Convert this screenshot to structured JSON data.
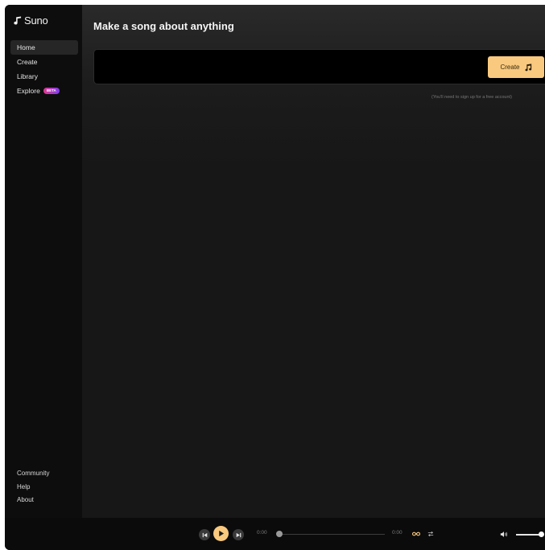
{
  "app": {
    "brand": "Suno"
  },
  "sidebar": {
    "items": [
      {
        "label": "Home",
        "active": true
      },
      {
        "label": "Create",
        "active": false
      },
      {
        "label": "Library",
        "active": false
      },
      {
        "label": "Explore",
        "active": false,
        "badge": "BETA"
      }
    ],
    "footer_items": [
      {
        "label": "Community"
      },
      {
        "label": "Help"
      },
      {
        "label": "About"
      }
    ]
  },
  "main": {
    "title": "Make a song about anything",
    "prompt": {
      "value": "",
      "placeholder": ""
    },
    "create_button": {
      "label": "Create",
      "icon": "music-note-icon"
    },
    "signup_note": "(You'll need to sign up for a free account)"
  },
  "player": {
    "time_elapsed": "0:00",
    "time_total": "0:00",
    "progress": 0,
    "volume": 1.0,
    "icons": {
      "prev": "skip-back-icon",
      "play": "play-icon",
      "next": "skip-forward-icon",
      "loop": "infinity-loop-icon",
      "shuffle": "shuffle-icon",
      "volume": "volume-icon"
    }
  },
  "colors": {
    "accent": "#f8c97f",
    "background": "#171717",
    "sidebar": "#0d0d0d",
    "active_item": "#262626"
  }
}
